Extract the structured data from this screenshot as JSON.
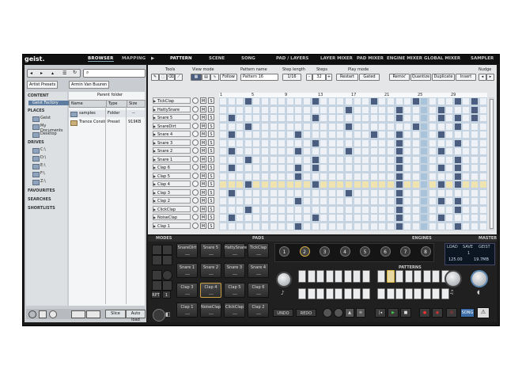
{
  "app": {
    "logo": "geist.",
    "browser_tabs": [
      "BROWSER",
      "MAPPING"
    ],
    "main_tabs": [
      "PATTERN",
      "SCENE",
      "SONG",
      "PAD / LAYERS",
      "LAYER MIXER",
      "PAD MIXER",
      "ENGINE MIXER",
      "GLOBAL MIXER",
      "SAMPLER"
    ]
  },
  "browser": {
    "breadcrumbs": [
      "Artist Presets",
      "Armin Van Buuren"
    ],
    "sections": {
      "content": "CONTENT",
      "places": "PLACES",
      "drives": "DRIVES",
      "favourites": "FAVOURITES",
      "searches": "SEARCHES",
      "shortlists": "SHORTLISTS"
    },
    "content_items": [
      "Geist Factory"
    ],
    "places_items": [
      "Geist",
      "My Documents",
      "Desktop"
    ],
    "drive_items": [
      "C:\\",
      "D:\\",
      "E:\\",
      "F:\\",
      "Z:\\"
    ],
    "parent_folder": "Parent folder",
    "columns": [
      "Name",
      "Type",
      "Size"
    ],
    "rows": [
      {
        "name": "samples",
        "type": "Folder",
        "size": "--"
      },
      {
        "name": "Trance Constr",
        "type": "Preset",
        "size": "919KB"
      }
    ],
    "bottom": {
      "slice": "Slice",
      "autoload": "Auto load"
    }
  },
  "pattern": {
    "labels": {
      "tools": "Tools",
      "view_mode": "View mode",
      "pattern_name": "Pattern name",
      "step_length": "Step length",
      "steps": "Steps",
      "play_mode": "Play mode",
      "nudge": "Nudge"
    },
    "follow": "Follow",
    "pattern_name": "Pattern 16",
    "step_length": "1/16",
    "steps": "32",
    "restart": "Restart",
    "gated": "Gated",
    "remix": "Remix'",
    "quantize": "Quantize",
    "duplicate": "Duplicate",
    "insert": "Insert",
    "step_numbers": [
      "1",
      "5",
      "9",
      "13",
      "17",
      "21",
      "25",
      "29"
    ],
    "m": "M",
    "s": "S",
    "tracks": [
      "TickClap",
      "HattySnare",
      "Snare 5",
      "SnareDirt",
      "Snare 4",
      "Snare 3",
      "Snare 2",
      "Snare 1",
      "Clap 6",
      "Clap 5",
      "Clap 4",
      "Clap 3",
      "Clap 2",
      "ClickClap",
      "NoiseClap",
      "Clap 1"
    ],
    "steps_on": [
      [
        3,
        11,
        18,
        23,
        28,
        30
      ],
      [
        15,
        21,
        26,
        30
      ],
      [
        1,
        11,
        21,
        26,
        28,
        30
      ],
      [
        3,
        15,
        23,
        28
      ],
      [
        1,
        9,
        18,
        21,
        26
      ],
      [
        11,
        21,
        28
      ],
      [
        1,
        9,
        15,
        21,
        26
      ],
      [
        3,
        11,
        21,
        28
      ],
      [
        1,
        9,
        11,
        21,
        26,
        28
      ],
      [
        9,
        21,
        28
      ],
      [
        3,
        11,
        21,
        26,
        28
      ],
      [
        1,
        15,
        21
      ],
      [
        9,
        21,
        26,
        28
      ],
      [
        3,
        21,
        28
      ],
      [
        1,
        11,
        21,
        26
      ],
      [
        9,
        21,
        28
      ]
    ]
  },
  "lower": {
    "sections": {
      "modes": "MODES",
      "pads": "PADS",
      "engines": "ENGINES",
      "master": "MASTER",
      "patterns": "PATTERNS"
    },
    "pads": [
      "SnareDirt",
      "Snare 5",
      "HattySnare",
      "TickClap",
      "Snare 1",
      "Snare 2",
      "Snare 3",
      "Snare 4",
      "Clap 3",
      "Clap 4",
      "Clap 5",
      "Clap 6",
      "Clap 1",
      "NoiseClap",
      "ClickClap",
      "Clap 2"
    ],
    "selected_pad": "Clap 4",
    "engines": [
      "1",
      "2",
      "3",
      "4",
      "5",
      "6",
      "7",
      "8"
    ],
    "selected_engine": "2",
    "selected_pattern_index": 9,
    "rpt": "RPT",
    "undo": "UNDO",
    "redo": "REDO",
    "song": "SONG",
    "master": {
      "load": "LOAD",
      "save": "SAVE",
      "geist": "GEIST",
      "slot": "1",
      "bpm": "125.00",
      "mem": "19.7MB"
    }
  }
}
